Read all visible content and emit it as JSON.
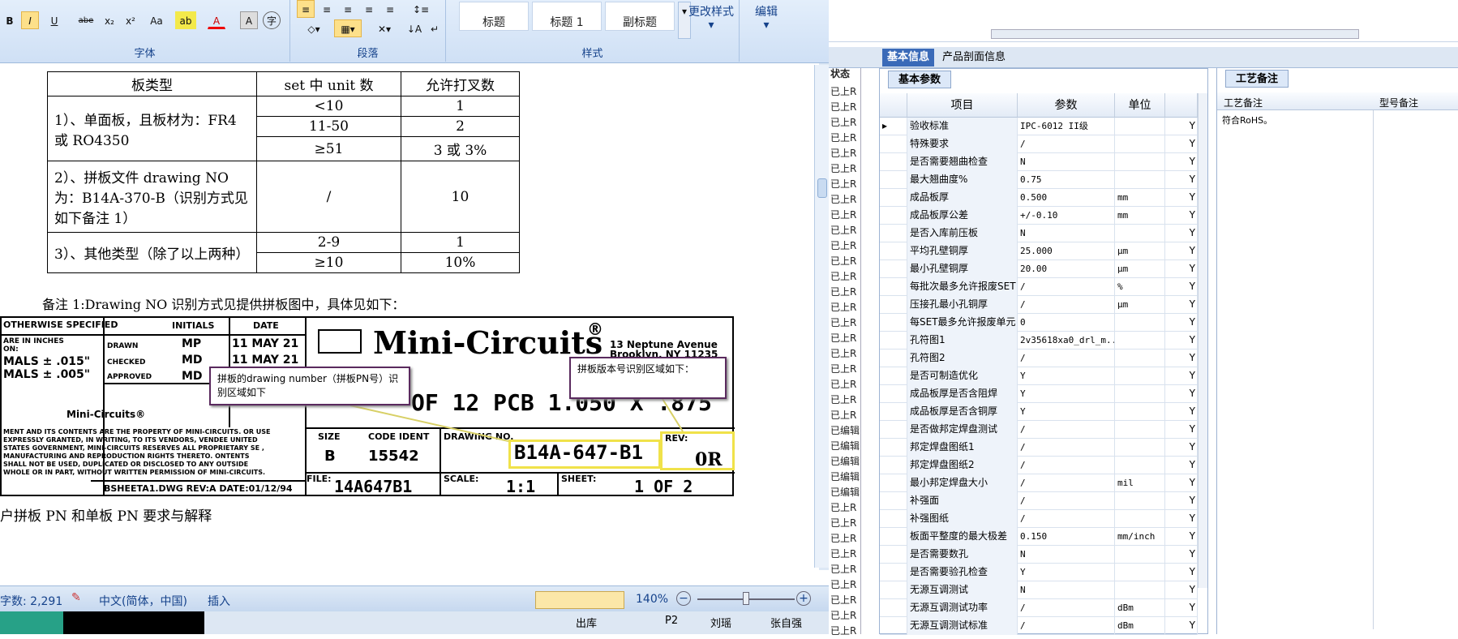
{
  "ribbon": {
    "font_group": "字体",
    "para_group": "段落",
    "style_group": "样式",
    "styles": [
      "标题",
      "标题 1",
      "副标题"
    ],
    "change_style": "更改样式",
    "edit": "编辑",
    "font_buttons": [
      "B",
      "I",
      "U",
      "abe",
      "x₂",
      "x²",
      "Aa",
      "A",
      "A"
    ]
  },
  "doc_table": {
    "headers": [
      "板类型",
      "set 中 unit 数",
      "允许打叉数"
    ],
    "rows": [
      {
        "type": "1）、单面板，且板材为：FR4 或 RO4350",
        "items": [
          [
            "<10",
            "1"
          ],
          [
            "11-50",
            "2"
          ],
          [
            "≥51",
            "3 或 3%"
          ]
        ]
      },
      {
        "type": "2）、拼板文件 drawing NO 为：B14A-370-B（识别方式见如下备注 1）",
        "items": [
          [
            "/",
            "10"
          ]
        ]
      },
      {
        "type": "3）、其他类型（除了以上两种）",
        "items": [
          [
            "2-9",
            "1"
          ],
          [
            "≥10",
            "10%"
          ]
        ]
      }
    ]
  },
  "note1": "备注 1:Drawing NO 识别方式见提供拼板图中，具体见如下：",
  "drawing": {
    "spec": "OTHERWISE SPECIFIED",
    "inches": "ARE IN INCHES",
    "on": "ON:",
    "mals1": "MALS ± .015\"",
    "mals2": "MALS ± .005\"",
    "initials": "INITIALS",
    "date": "DATE",
    "drawn": "DRAWN",
    "checked": "CHECKED",
    "approved": "APPROVED",
    "mp": "MP",
    "md1": "MD",
    "md2": "MD",
    "date1": "11 MAY 21",
    "date2": "11 MAY 21",
    "company": "Mini-Circuits",
    "reg": "®",
    "addr1": "13 Neptune Avenue",
    "addr2": "Brooklyn, NY 11235",
    "mini_small": "Mini-Circuits®",
    "legal": "MENT AND ITS CONTENTS ARE THE PROPERTY OF MINI-CIRCUITS. OR USE EXPRESSLY GRANTED, IN WRITING, TO ITS VENDORS, VENDEE UNITED STATES GOVERNMENT, MINI-CIRCUITS RESERVES ALL PROPRIETARY SE , MANUFACTURING AND REPRODUCTION RIGHTS THERETO. ONTENTS SHALL NOT BE USED, DUPLICATED OR DISCLOSED TO ANY OUTSIDE WHOLE OR IN PART, WITHOUT WRITTEN PERMISSION OF MINI-CIRCUITS.",
    "sheet_ref": "BSHEETA1.DWG REV:A DATE:01/12/94",
    "title": "OF 12 PCB 1.050 X .875",
    "size_label": "SIZE",
    "size": "B",
    "code_label": "CODE IDENT",
    "code": "15542",
    "drawing_no_label": "DRAWING NO.",
    "drawing_no": "B14A-647-B1",
    "rev_label": "REV:",
    "rev": "0R",
    "file_label": "FILE:",
    "file": "14A647B1",
    "scale_label": "SCALE:",
    "scale": "1:1",
    "sheet_label": "SHEET:",
    "sheet": "1 OF 2",
    "callout1": "拼板的drawing number（拼板PN号）识别区域如下",
    "callout2": "拼板版本号识别区域如下："
  },
  "bottom_text": "户拼板 PN 和单板 PN 要求与解释",
  "status": {
    "words": "字数: 2,291",
    "lang": "中文(简体，中国)",
    "insert": "插入",
    "zoom": "140%"
  },
  "task": {
    "c1": "出库",
    "c2": "P2",
    "c3": "刘瑶",
    "c4": "张自强"
  },
  "right": {
    "tab_basic": "基本信息",
    "tab_profile": "产品剖面信息",
    "status_header": "状态",
    "status_items": [
      "已上R",
      "已上R",
      "已上R",
      "已上R",
      "已上R",
      "已上R",
      "已上R",
      "已上R",
      "已上R",
      "已上R",
      "已上R",
      "已上R",
      "已上R",
      "已上R",
      "已上R",
      "已上R",
      "已上R",
      "已上R",
      "已上R",
      "已上R",
      "已上R",
      "已上R",
      "已编辑",
      "已编辑",
      "已编辑",
      "已编辑",
      "已编辑",
      "已上R",
      "已上R",
      "已上R",
      "已上R",
      "已上R",
      "已上R",
      "已上R",
      "已上R",
      "已上R"
    ],
    "sub_basic": "基本参数",
    "sub_craft": "工艺备注",
    "col_item": "项目",
    "col_param": "参数",
    "col_unit": "单位",
    "craft_col1": "工艺备注",
    "craft_col2": "型号备注",
    "craft_val": "符合RoHS。",
    "rows": [
      {
        "n": "验收标准",
        "v": "IPC-6012 II级",
        "u": "",
        "f": "Y"
      },
      {
        "n": "特殊要求",
        "v": "/",
        "u": "",
        "f": "Y"
      },
      {
        "n": "是否需要翘曲检查",
        "v": "N",
        "u": "",
        "f": "Y"
      },
      {
        "n": "最大翘曲度%",
        "v": "0.75",
        "u": "",
        "f": "Y"
      },
      {
        "n": "成品板厚",
        "v": "0.500",
        "u": "mm",
        "f": "Y"
      },
      {
        "n": "成品板厚公差",
        "v": "+/-0.10",
        "u": "mm",
        "f": "Y"
      },
      {
        "n": "是否入库前压板",
        "v": "N",
        "u": "",
        "f": "Y"
      },
      {
        "n": "平均孔壁铜厚",
        "v": "25.000",
        "u": "μm",
        "f": "Y"
      },
      {
        "n": "最小孔壁铜厚",
        "v": "20.00",
        "u": "μm",
        "f": "Y"
      },
      {
        "n": "每批次最多允许报废SET",
        "v": "/",
        "u": "%",
        "f": "Y"
      },
      {
        "n": "压接孔最小孔铜厚",
        "v": "/",
        "u": "μm",
        "f": "Y"
      },
      {
        "n": "每SET最多允许报废单元",
        "v": "0",
        "u": "",
        "f": "Y"
      },
      {
        "n": "孔符图1",
        "v": "2v35618xa0_drl_m...",
        "u": "",
        "f": "Y"
      },
      {
        "n": "孔符图2",
        "v": "/",
        "u": "",
        "f": "Y"
      },
      {
        "n": "是否可制造优化",
        "v": "Y",
        "u": "",
        "f": "Y"
      },
      {
        "n": "成品板厚是否含阻焊",
        "v": "Y",
        "u": "",
        "f": "Y"
      },
      {
        "n": "成品板厚是否含铜厚",
        "v": "Y",
        "u": "",
        "f": "Y"
      },
      {
        "n": "是否做邦定焊盘测试",
        "v": "/",
        "u": "",
        "f": "Y"
      },
      {
        "n": "邦定焊盘图纸1",
        "v": "/",
        "u": "",
        "f": "Y"
      },
      {
        "n": "邦定焊盘图纸2",
        "v": "/",
        "u": "",
        "f": "Y"
      },
      {
        "n": "最小邦定焊盘大小",
        "v": "/",
        "u": "mil",
        "f": "Y"
      },
      {
        "n": "补强面",
        "v": "/",
        "u": "",
        "f": "Y"
      },
      {
        "n": "补强图纸",
        "v": "/",
        "u": "",
        "f": "Y"
      },
      {
        "n": "板面平整度的最大极差",
        "v": "0.150",
        "u": "mm/inch",
        "f": "Y"
      },
      {
        "n": "是否需要数孔",
        "v": "N",
        "u": "",
        "f": "Y"
      },
      {
        "n": "是否需要验孔检查",
        "v": "Y",
        "u": "",
        "f": "Y"
      },
      {
        "n": "无源互调测试",
        "v": "N",
        "u": "",
        "f": "Y"
      },
      {
        "n": "无源互调测试功率",
        "v": "/",
        "u": "dBm",
        "f": "Y"
      },
      {
        "n": "无源互调测试标准",
        "v": "/",
        "u": "dBm",
        "f": "Y"
      }
    ]
  }
}
